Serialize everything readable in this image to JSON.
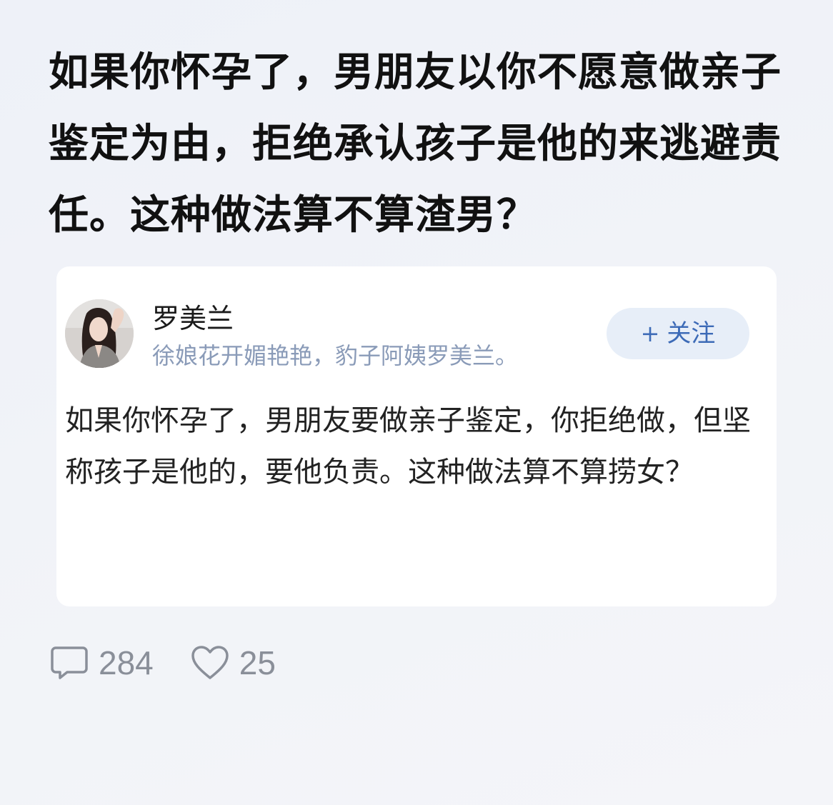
{
  "post": {
    "title": "如果你怀孕了，男朋友以你不愿意做亲子鉴定为由，拒绝承认孩子是他的来逃避责任。这种做法算不算渣男？"
  },
  "quoted": {
    "author_name": "罗美兰",
    "author_bio": "徐娘花开媚艳艳，豹子阿姨罗美兰。",
    "follow_label": "关注",
    "follow_icon": "plus-icon",
    "body": "如果你怀孕了，男朋友要做亲子鉴定，你拒绝做，但坚称孩子是他的，要他负责。这种做法算不算捞女？"
  },
  "stats": {
    "comments": "284",
    "likes": "25",
    "comment_icon": "comment-icon",
    "like_icon": "heart-icon"
  },
  "colors": {
    "bio": "#8a9bb8",
    "follow_text": "#3d6bb7",
    "follow_bg": "#e7eef8",
    "stats": "#8a8f99"
  }
}
